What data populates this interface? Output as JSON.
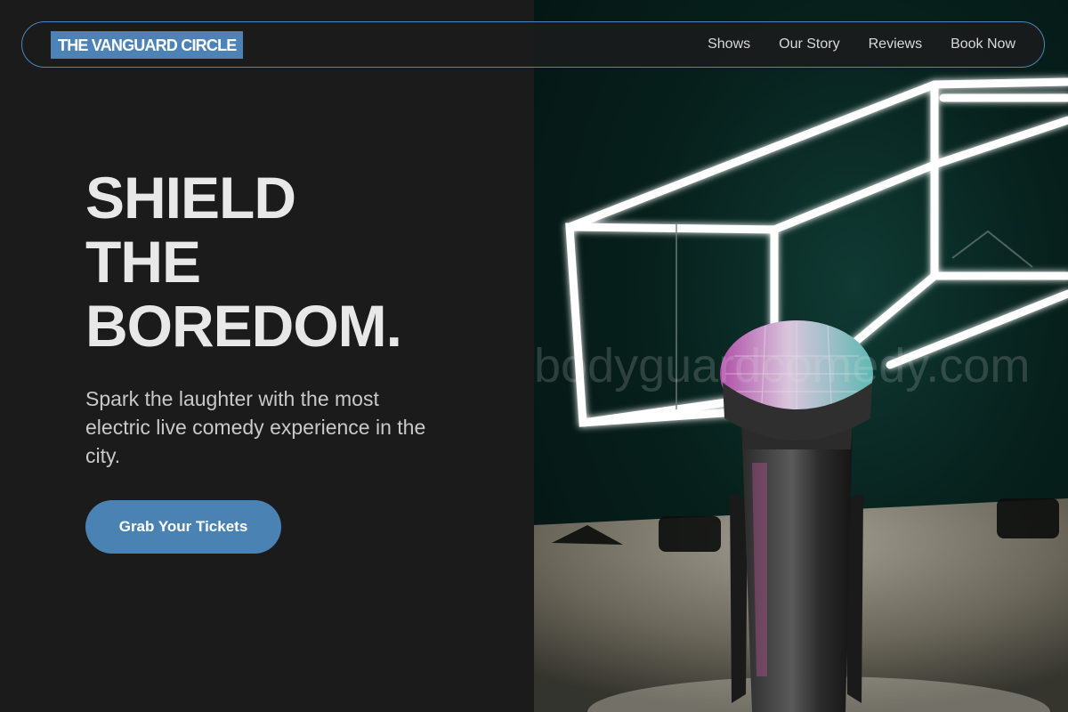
{
  "brand": {
    "name": "THE VANGUARD CIRCLE",
    "accent_color": "#4c82b6"
  },
  "nav": {
    "links": [
      {
        "label": "Shows"
      },
      {
        "label": "Our Story"
      },
      {
        "label": "Reviews"
      },
      {
        "label": "Book Now"
      }
    ]
  },
  "hero": {
    "title_lines": [
      "SHIELD",
      "THE",
      "BOREDOM."
    ],
    "subtitle": "Spark the laughter with the most electric live comedy experience in the city.",
    "cta_label": "Grab Your Tickets",
    "watermark": "bodyguardcomedy.com",
    "image_subject": "microphone-on-stage-neon-cube"
  },
  "colors": {
    "background": "#1b1b1c",
    "text": "#e8e8e8",
    "button": "#4a82b4"
  }
}
